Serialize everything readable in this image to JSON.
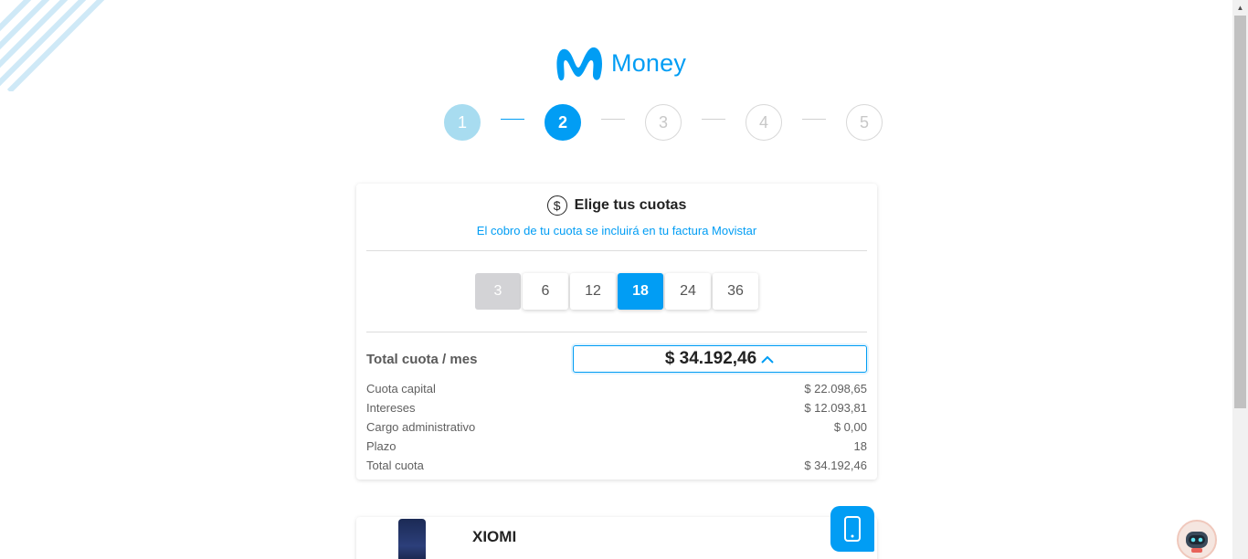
{
  "brand": {
    "name": "Money",
    "accent": "#019df4"
  },
  "steps": [
    {
      "number": "1",
      "state": "done"
    },
    {
      "number": "2",
      "state": "active"
    },
    {
      "number": "3",
      "state": "pending"
    },
    {
      "number": "4",
      "state": "pending"
    },
    {
      "number": "5",
      "state": "pending"
    }
  ],
  "installments": {
    "icon": "dollar-circle-icon",
    "title": "Elige tus cuotas",
    "subtitle": "El cobro de tu cuota se incluirá en tu factura Movistar",
    "terms": [
      {
        "label": "3",
        "state": "disabled"
      },
      {
        "label": "6",
        "state": "normal"
      },
      {
        "label": "12",
        "state": "normal"
      },
      {
        "label": "18",
        "state": "selected"
      },
      {
        "label": "24",
        "state": "normal"
      },
      {
        "label": "36",
        "state": "normal"
      }
    ],
    "total_label": "Total cuota / mes",
    "total_value": "$ 34.192,46",
    "details": [
      {
        "label": "Cuota capital",
        "value": "$ 22.098,65"
      },
      {
        "label": "Intereses",
        "value": "$ 12.093,81"
      },
      {
        "label": "Cargo administrativo",
        "value": "$ 0,00"
      },
      {
        "label": "Plazo",
        "value": "18"
      },
      {
        "label": "Total cuota",
        "value": "$ 34.192,46"
      }
    ]
  },
  "product": {
    "name": "XIOMI",
    "badge_icon": "smartphone-icon"
  },
  "chat": {
    "icon": "robot-icon"
  }
}
